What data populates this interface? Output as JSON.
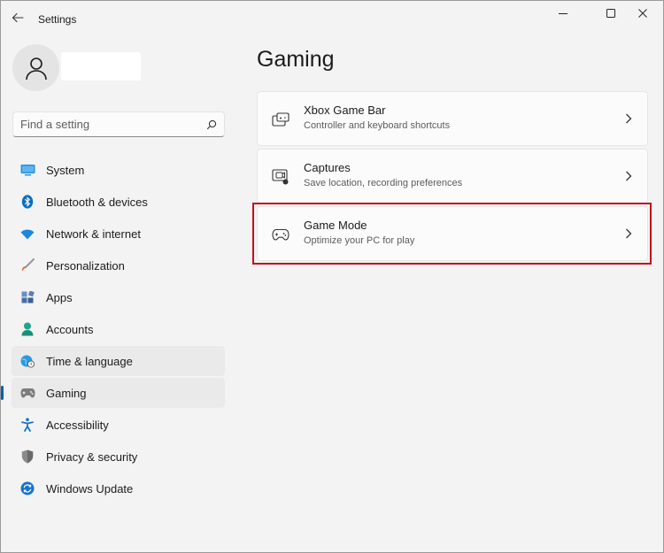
{
  "titlebar": {
    "app_title": "Settings",
    "back_icon": "back-arrow-icon",
    "minimize_icon": "minimize-icon",
    "maximize_icon": "maximize-icon",
    "close_icon": "close-icon"
  },
  "profile": {
    "avatar_icon": "user-icon"
  },
  "search": {
    "placeholder": "Find a setting",
    "value": "",
    "icon": "search-icon"
  },
  "sidebar": {
    "items": [
      {
        "label": "System",
        "icon": "system-monitor-icon",
        "color": "#0078d4"
      },
      {
        "label": "Bluetooth & devices",
        "icon": "bluetooth-icon",
        "color": "#0078d4"
      },
      {
        "label": "Network & internet",
        "icon": "wifi-icon",
        "color": "#0a84d6"
      },
      {
        "label": "Personalization",
        "icon": "paintbrush-icon",
        "color": "#e0763a"
      },
      {
        "label": "Apps",
        "icon": "apps-icon",
        "color": "#4a6fa5"
      },
      {
        "label": "Accounts",
        "icon": "accounts-icon",
        "color": "#1ca58a"
      },
      {
        "label": "Time & language",
        "icon": "globe-clock-icon",
        "color": "#1d8fd8"
      },
      {
        "label": "Gaming",
        "icon": "gamepad-icon",
        "color": "#6d6d6d"
      },
      {
        "label": "Accessibility",
        "icon": "accessibility-icon",
        "color": "#1a73c9"
      },
      {
        "label": "Privacy & security",
        "icon": "shield-icon",
        "color": "#7a7a7a"
      },
      {
        "label": "Windows Update",
        "icon": "update-icon",
        "color": "#1a73c9"
      }
    ],
    "selected": "Gaming"
  },
  "main": {
    "title": "Gaming",
    "cards": [
      {
        "title": "Xbox Game Bar",
        "subtitle": "Controller and keyboard shortcuts",
        "icon": "game-bar-icon"
      },
      {
        "title": "Captures",
        "subtitle": "Save location, recording preferences",
        "icon": "captures-icon"
      },
      {
        "title": "Game Mode",
        "subtitle": "Optimize your PC for play",
        "icon": "gamepad-icon"
      }
    ],
    "highlight_color": "#c0111a"
  }
}
